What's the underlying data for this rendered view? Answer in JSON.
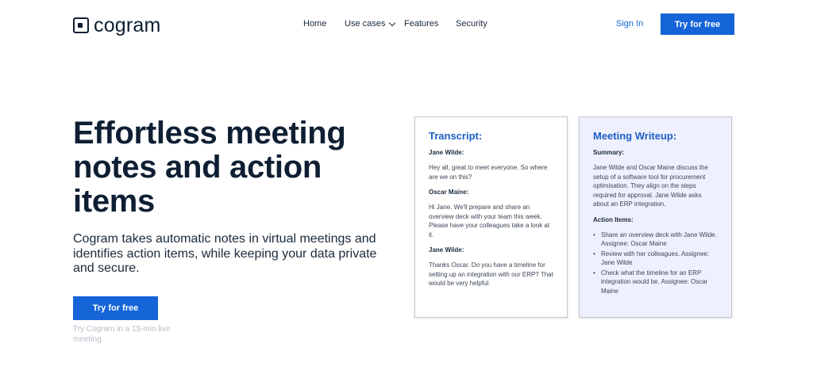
{
  "header": {
    "logo_text": "cogram",
    "nav": [
      {
        "label": "Home"
      },
      {
        "label": "Use cases"
      },
      {
        "label": "Features"
      },
      {
        "label": "Security"
      }
    ],
    "signin_label": "Sign In",
    "cta_label": "Try for free"
  },
  "hero": {
    "title": "Effortless meeting notes and action items",
    "subtitle": "Cogram takes automatic notes in virtual meetings and identifies action items, while keeping your data private and secure.",
    "cta_label": "Try for free",
    "note": "Try Cogram in a 15-min live meeting."
  },
  "transcript": {
    "title": "Transcript:",
    "entries": [
      {
        "speaker": "Jane Wilde:",
        "text": "Hey all, great to meet everyone. So where are we on this?"
      },
      {
        "speaker": "Oscar Maine:",
        "text": "Hi Jane. We'll prepare and share an overview deck with your team this week. Please have your colleagues take a look at it."
      },
      {
        "speaker": "Jane Wilde:",
        "text": "Thanks Oscar. Do you have a timeline for setting up an integration with our ERP? That would be very helpful."
      }
    ]
  },
  "writeup": {
    "title": "Meeting Writeup:",
    "summary_label": "Summary:",
    "summary_text": "Jane Wilde and Oscar Maine discuss the setup of a software tool for procurement optimisation. They align on the steps required for approval. Jane Wilde asks about an ERP integration.",
    "actions_label": "Action Items:",
    "actions": [
      "Share an overview deck with Jane Wilde. Assignee: Oscar Maine",
      "Review with her colleagues. Assignee: Jane Wilde",
      "Check what the timeline for an ERP integration would be. Assignee: Oscar Maine"
    ]
  },
  "colors": {
    "brand_blue": "#1565d8",
    "heading_navy": "#0f1f33",
    "writeup_bg": "#eef0fd"
  }
}
